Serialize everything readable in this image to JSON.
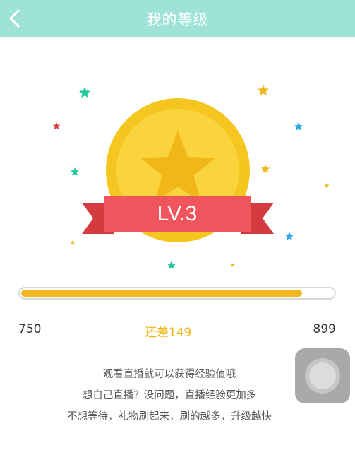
{
  "header": {
    "title": "我的等级",
    "back_icon": "chevron-left-icon"
  },
  "badge": {
    "level_text": "LV.3"
  },
  "progress": {
    "start": 750,
    "end": 899,
    "fraction": 0.9
  },
  "stats": {
    "min": "750",
    "remaining": "还差149",
    "max": "899"
  },
  "tips": [
    "观看直播就可以获得经验值哦",
    "想自己直播？没问题，直播经验更加多",
    "不想等待，礼物刷起来，刷的越多，升级越快"
  ],
  "colors": {
    "header": "#9fe3d8",
    "accent": "#f0b81e",
    "ribbon": "#f0555e"
  },
  "floating_button": {
    "icon": "assistive-touch-icon"
  }
}
